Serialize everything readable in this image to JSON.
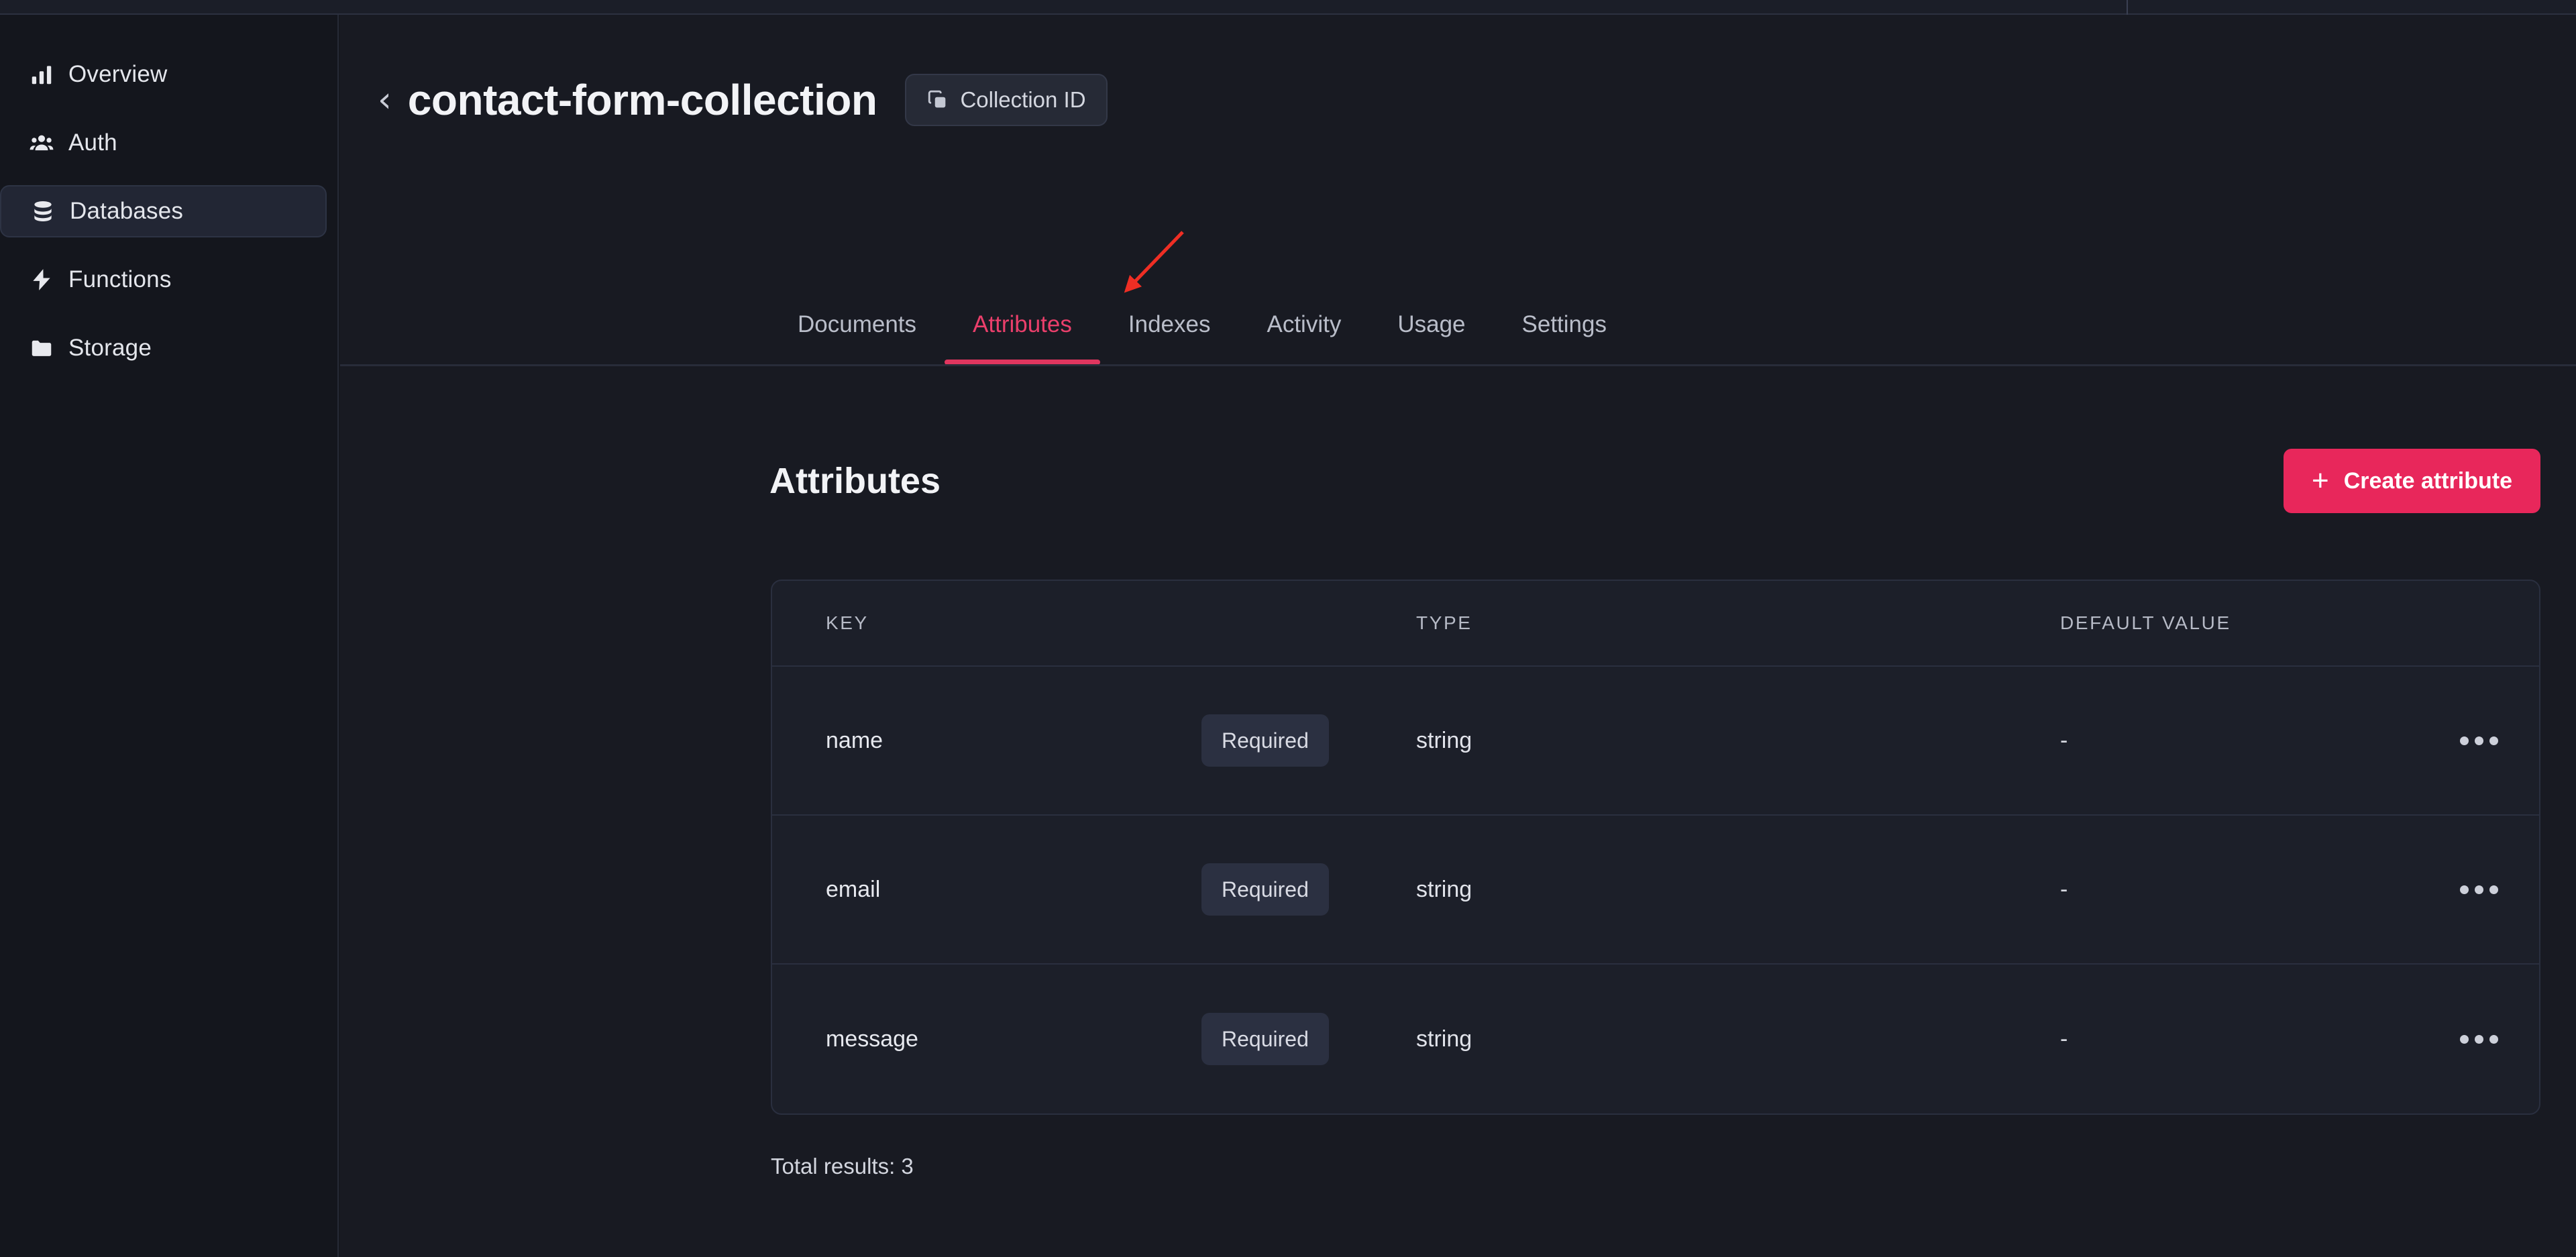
{
  "theme": {
    "page_bg": "#181a22",
    "sidebar_bg": "#14161d",
    "card_bg": "#1c1f29",
    "accent_pink": "#e8275b",
    "accent_tab": "#ea3f6b",
    "annotation_red": "#ee2e24"
  },
  "sidebar": {
    "items": [
      {
        "label": "Overview",
        "icon": "bar-chart-icon",
        "active": false
      },
      {
        "label": "Auth",
        "icon": "users-icon",
        "active": false
      },
      {
        "label": "Databases",
        "icon": "database-icon",
        "active": true
      },
      {
        "label": "Functions",
        "icon": "lightning-icon",
        "active": false
      },
      {
        "label": "Storage",
        "icon": "folder-icon",
        "active": false
      }
    ]
  },
  "header": {
    "back_chevron": "‹",
    "title": "contact-form-collection",
    "collection_id_label": "Collection ID",
    "collection_id_icon": "copy-icon"
  },
  "tabs": [
    {
      "label": "Documents",
      "active": false
    },
    {
      "label": "Attributes",
      "active": true
    },
    {
      "label": "Indexes",
      "active": false
    },
    {
      "label": "Activity",
      "active": false
    },
    {
      "label": "Usage",
      "active": false
    },
    {
      "label": "Settings",
      "active": false
    }
  ],
  "annotation": {
    "type": "arrow",
    "color": "#ee2e24",
    "points_at": "Attributes"
  },
  "section": {
    "title": "Attributes",
    "create_button_label": "Create attribute",
    "create_button_icon": "plus-icon"
  },
  "table": {
    "columns": [
      "KEY",
      "TYPE",
      "DEFAULT VALUE"
    ],
    "rows": [
      {
        "key": "name",
        "badge": "Required",
        "type": "string",
        "default": "-",
        "actions_icon": "more-options-icon"
      },
      {
        "key": "email",
        "badge": "Required",
        "type": "string",
        "default": "-",
        "actions_icon": "more-options-icon"
      },
      {
        "key": "message",
        "badge": "Required",
        "type": "string",
        "default": "-",
        "actions_icon": "more-options-icon"
      }
    ]
  },
  "footer": {
    "total_results": "Total results: 3"
  }
}
